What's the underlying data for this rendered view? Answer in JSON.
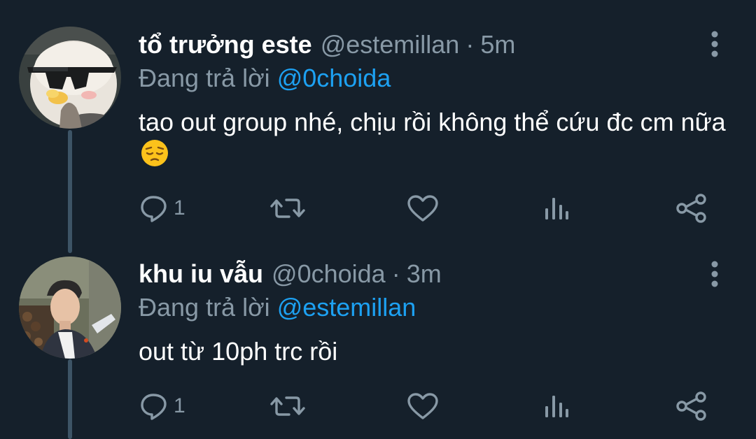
{
  "colors": {
    "background": "#15202b",
    "text_primary": "#ffffff",
    "text_secondary": "#8899a6",
    "link": "#1da1f2",
    "thread_line": "#3d5466"
  },
  "tweets": [
    {
      "display_name": "tổ trưởng este",
      "handle": "@estemillan",
      "separator": "·",
      "time": "5m",
      "reply_prefix": "Đang trả lời",
      "reply_to": "@0choida",
      "text": "tao out group nhé, chịu rồi không thể cứu đc cm nữa",
      "emoji": "pensive-face-emoji",
      "avatar": "penguin-with-sunglasses-avatar",
      "reply_count": "1",
      "icons": [
        "reply-icon",
        "retweet-icon",
        "like-icon",
        "views-icon",
        "share-icon",
        "more-options-icon"
      ]
    },
    {
      "display_name": "khu iu vẫu",
      "handle": "@0choida",
      "separator": "·",
      "time": "3m",
      "reply_prefix": "Đang trả lời",
      "reply_to": "@estemillan",
      "text": "out từ 10ph trc rồi",
      "avatar": "young-man-photo-avatar",
      "reply_count": "1",
      "icons": [
        "reply-icon",
        "retweet-icon",
        "like-icon",
        "views-icon",
        "share-icon",
        "more-options-icon"
      ]
    }
  ]
}
